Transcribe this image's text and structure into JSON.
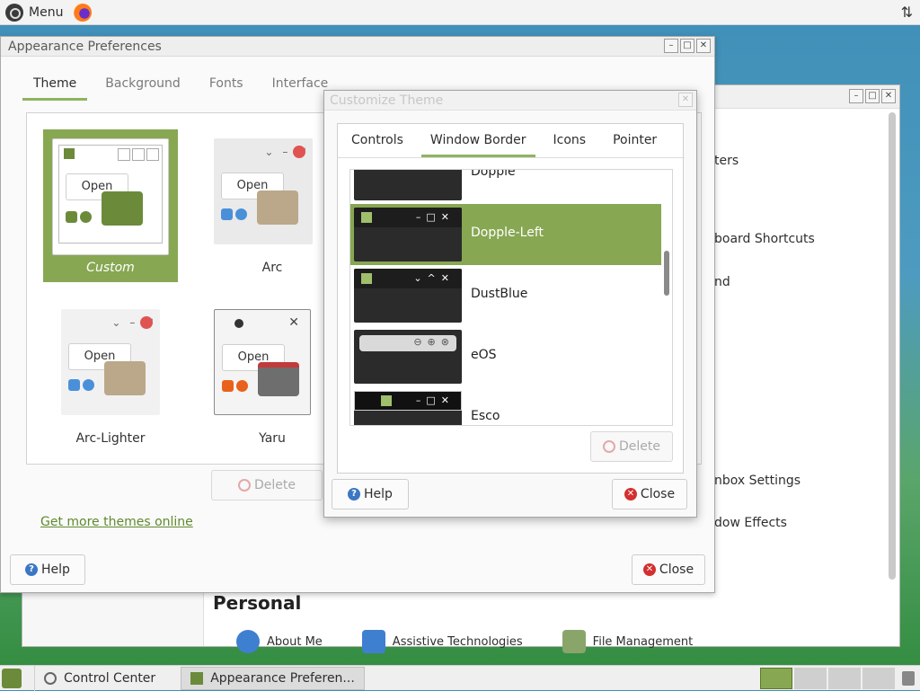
{
  "top_panel": {
    "menu_label": "Menu"
  },
  "control_center": {
    "items": [
      "ters",
      "board Shortcuts",
      "nd",
      "nbox Settings",
      "dow Effects"
    ],
    "personal_heading": "Personal",
    "personal_items": [
      "About Me",
      "Assistive Technologies",
      "File Management"
    ]
  },
  "appearance": {
    "title": "Appearance Preferences",
    "tabs": [
      "Theme",
      "Background",
      "Fonts",
      "Interface"
    ],
    "active_tab": "Theme",
    "themes": [
      {
        "name": "Custom",
        "selected": true
      },
      {
        "name": "Arc",
        "selected": false
      },
      {
        "name": "Arc-Lighter",
        "selected": false
      },
      {
        "name": "Yaru",
        "selected": false
      }
    ],
    "thumb_open_label": "Open",
    "delete_label": "Delete",
    "more_themes_link": "Get more themes online",
    "help_label": "Help",
    "close_label": "Close"
  },
  "customize": {
    "title": "Customize Theme",
    "tabs": [
      "Controls",
      "Window Border",
      "Icons",
      "Pointer"
    ],
    "active_tab": "Window Border",
    "border_themes": [
      {
        "name": "Dopple",
        "selected": false
      },
      {
        "name": "Dopple-Left",
        "selected": true
      },
      {
        "name": "DustBlue",
        "selected": false
      },
      {
        "name": "eOS",
        "selected": false
      },
      {
        "name": "Esco",
        "selected": false
      }
    ],
    "delete_label": "Delete",
    "help_label": "Help",
    "close_label": "Close"
  },
  "taskbar": {
    "items": [
      "Control Center",
      "Appearance Preferen..."
    ]
  },
  "colors": {
    "accent": "#87a752",
    "close_red": "#d42f2f",
    "help_blue": "#3b77c4"
  }
}
